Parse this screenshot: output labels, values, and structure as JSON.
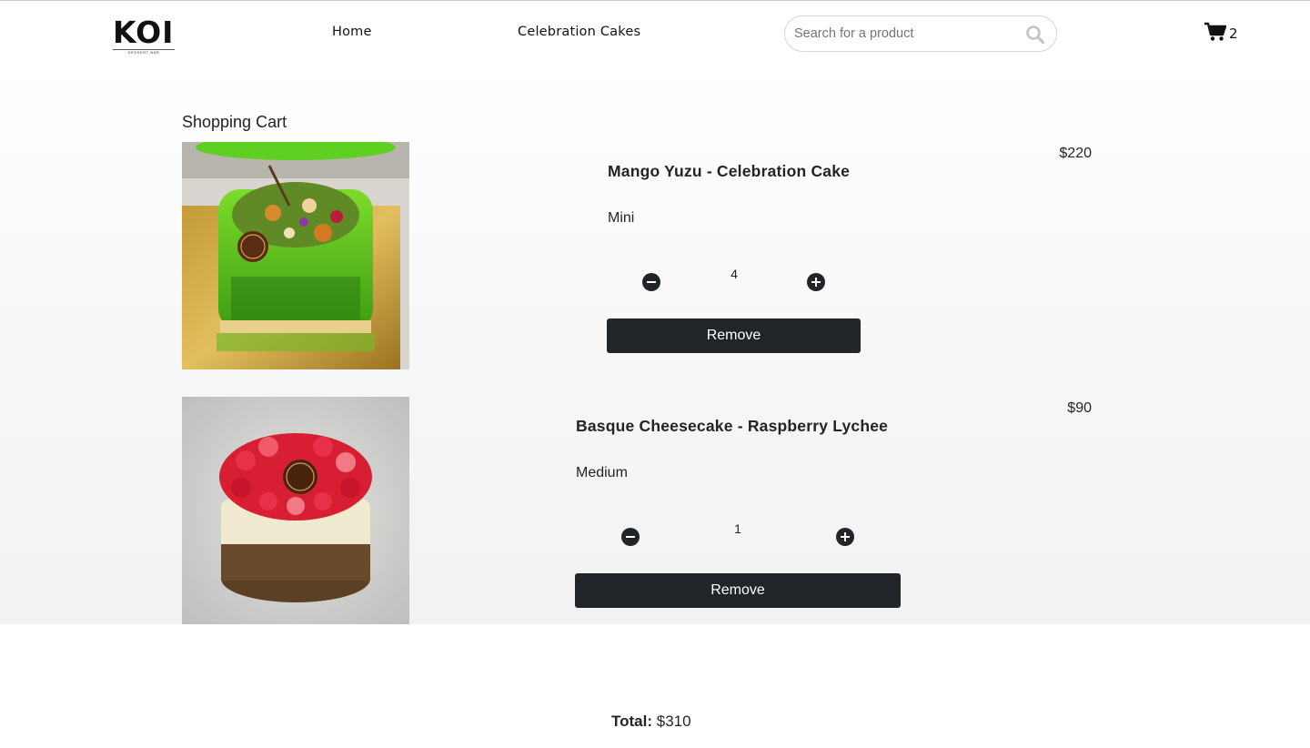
{
  "brand": {
    "logo_text": "KOI",
    "logo_subtext": "DESSERT BAR"
  },
  "nav": {
    "home": "Home",
    "celebration_cakes": "Celebration Cakes"
  },
  "search": {
    "placeholder": "Search for a product",
    "value": ""
  },
  "cart_badge": {
    "count": "2"
  },
  "cart": {
    "title": "Shopping Cart",
    "items": [
      {
        "name": "Mango Yuzu - Celebration Cake",
        "size": "Mini",
        "quantity": "4",
        "price": "$220",
        "remove_label": "Remove",
        "image_alt": "Mango Yuzu celebration cake"
      },
      {
        "name": "Basque Cheesecake - Raspberry Lychee",
        "size": "Medium",
        "quantity": "1",
        "price": "$90",
        "remove_label": "Remove",
        "image_alt": "Basque cheesecake raspberry lychee"
      }
    ],
    "total_label": "Total:",
    "total_value": "$310"
  },
  "icons": [
    "search-icon",
    "shopping-cart-icon",
    "minus-circle-icon",
    "plus-circle-icon"
  ],
  "colors": {
    "button_dark": "#212529",
    "text": "#212529",
    "page_bg": "#ffffff"
  }
}
